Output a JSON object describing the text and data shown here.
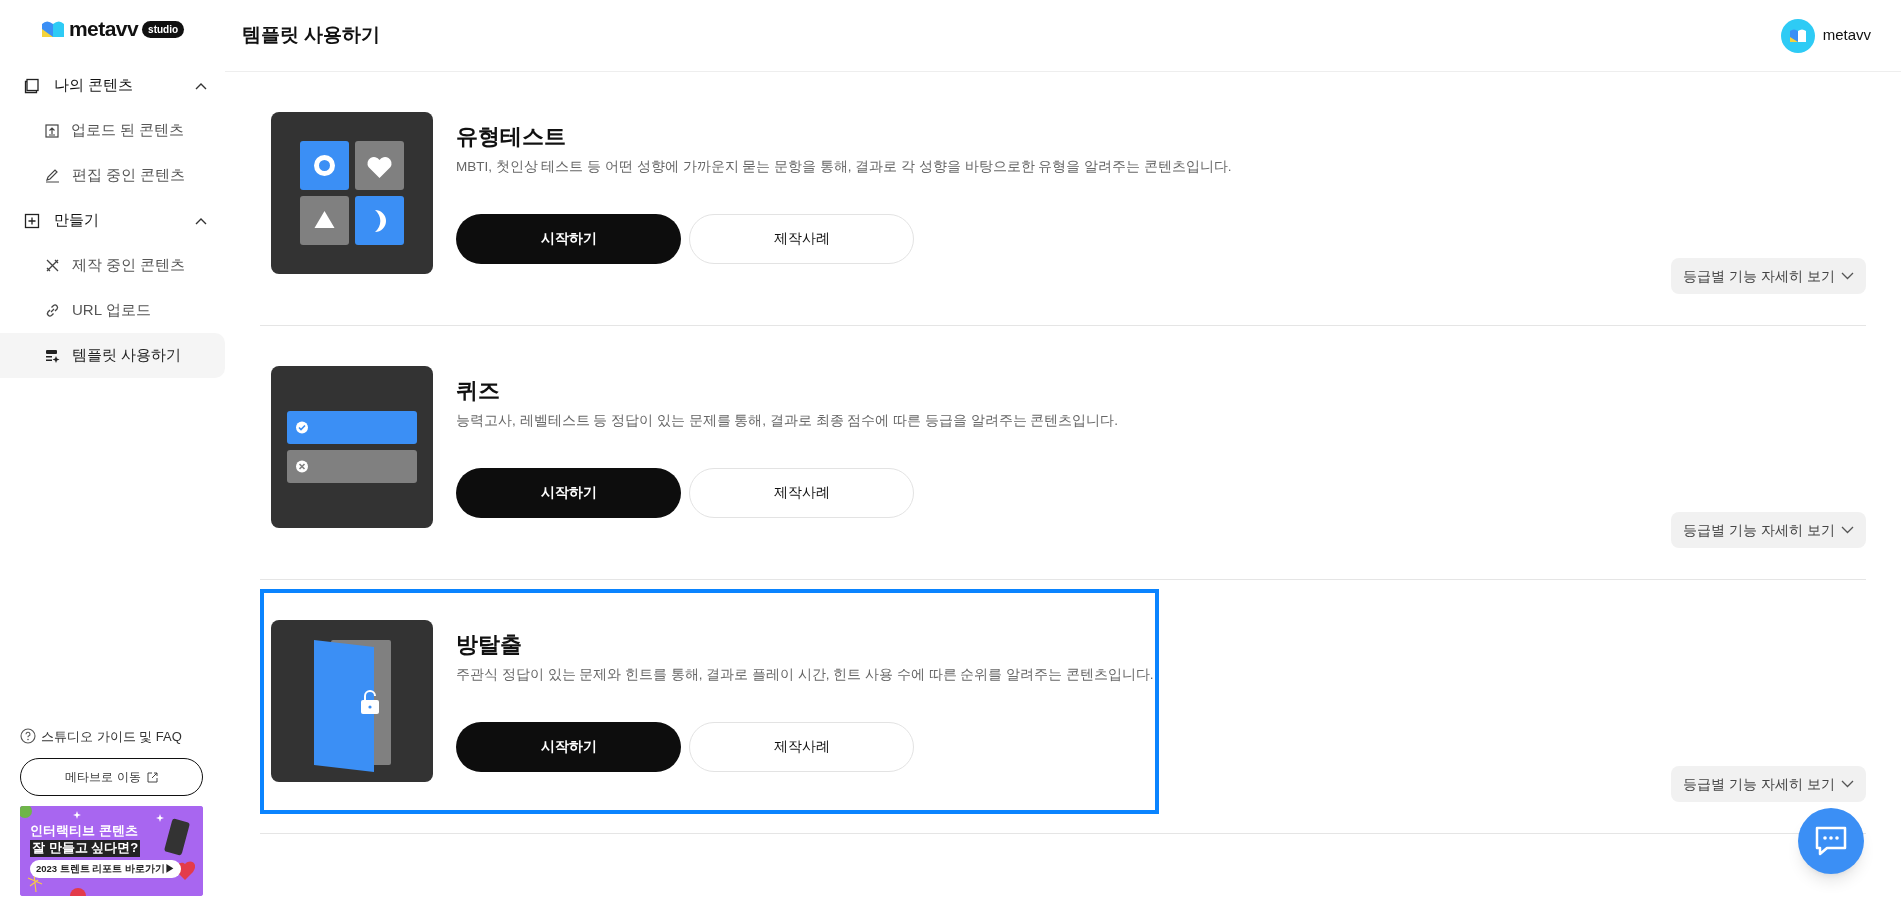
{
  "logo": {
    "wordmark": "metavv",
    "badge": "studio"
  },
  "sidebar": {
    "groups": [
      {
        "label": "나의 콘텐츠",
        "expanded": true,
        "children": [
          {
            "label": "업로드 된 콘텐츠",
            "selected": false
          },
          {
            "label": "편집 중인 콘텐츠",
            "selected": false
          }
        ]
      },
      {
        "label": "만들기",
        "expanded": true,
        "children": [
          {
            "label": "제작 중인 콘텐츠",
            "selected": false
          },
          {
            "label": "URL 업로드",
            "selected": false
          },
          {
            "label": "템플릿 사용하기",
            "selected": true
          }
        ]
      }
    ],
    "guide_link": "스튜디오 가이드 및 FAQ",
    "metaverse_button": "메타브로 이동",
    "banner": {
      "line_1": "인터랙티브 콘텐츠",
      "line_2": "잘 만들고 싶다면?",
      "cta": "2023 트렌트 리포트 바로가기▶"
    }
  },
  "header": {
    "title": "템플릿 사용하기",
    "user": "metavv"
  },
  "templates": [
    {
      "kind": "grid",
      "title": "유형테스트",
      "description": "MBTI, 첫인상 테스트 등 어떤 성향에 가까운지 묻는 문항을 통해, 결과로 각 성향을 바탕으로한 유형을 알려주는 콘텐츠입니다.",
      "start_button": "시작하기",
      "example_button": "제작사례",
      "details_button": "등급별 기능 자세히 보기",
      "highlighted": false
    },
    {
      "kind": "quiz",
      "title": "퀴즈",
      "description": "능력고사, 레벨테스트 등 정답이 있는 문제를 통해, 결과로 최종 점수에 따른 등급을 알려주는 콘텐츠입니다.",
      "start_button": "시작하기",
      "example_button": "제작사례",
      "details_button": "등급별 기능 자세히 보기",
      "highlighted": false
    },
    {
      "kind": "door",
      "title": "방탈출",
      "description": "주관식 정답이 있는 문제와 힌트를 통해, 결과로 플레이 시간, 힌트 사용 수에 따른 순위를 알려주는 콘텐츠입니다.",
      "start_button": "시작하기",
      "example_button": "제작사례",
      "details_button": "등급별 기능 자세히 보기",
      "highlighted": true
    }
  ]
}
